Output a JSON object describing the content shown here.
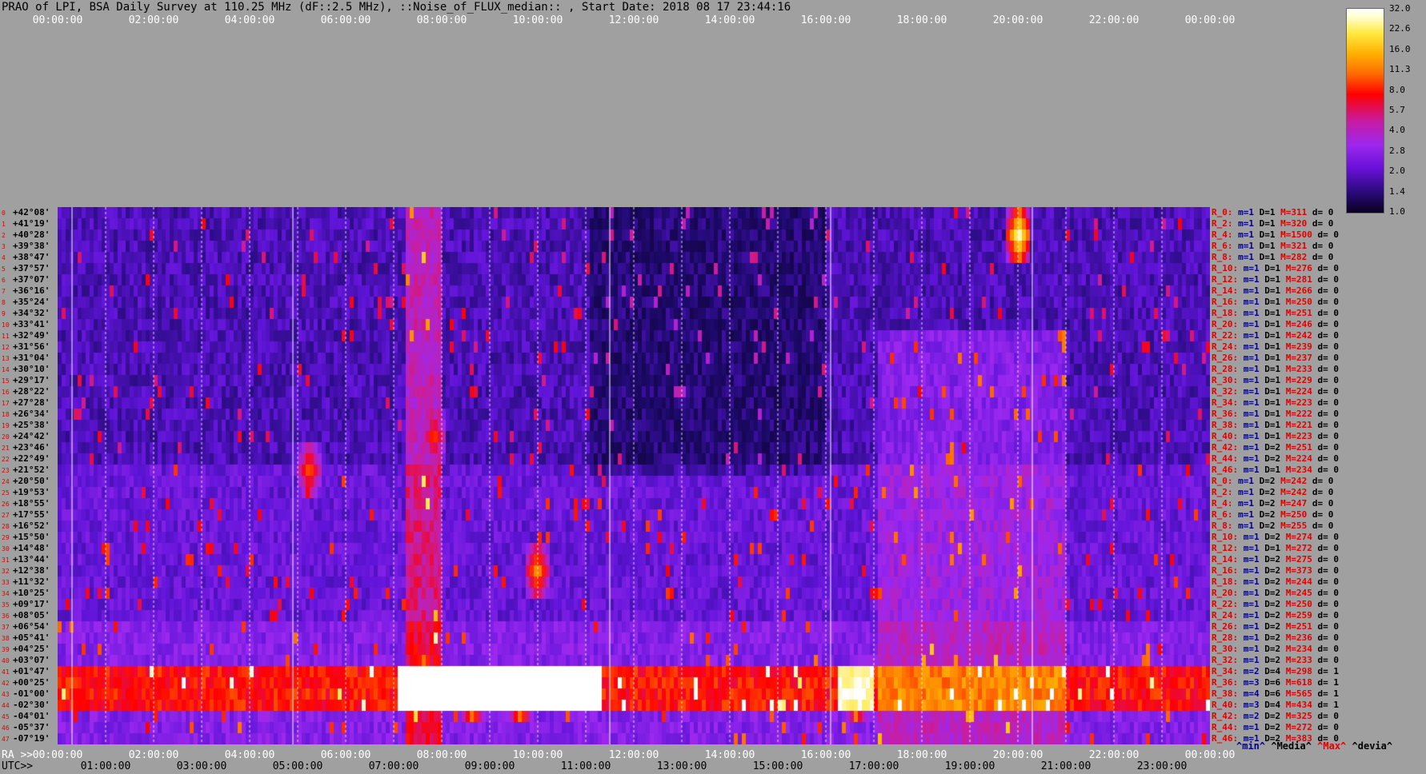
{
  "title": "PRAO of LPI, BSA Daily Survey at 110.25 MHz (dF::2.5 MHz), ::Noise_of_FLUX_median:: , Start Date: 2018 08 17 23:44:16",
  "chart_data": {
    "type": "heatmap",
    "title": "PRAO of LPI, BSA Daily Survey at 110.25 MHz (dF::2.5 MHz), ::Noise_of_FLUX_median:: , Start Date: 2018 08 17 23:44:16",
    "x_axis_top": [
      "00:00:00",
      "02:00:00",
      "04:00:00",
      "06:00:00",
      "08:00:00",
      "10:00:00",
      "12:00:00",
      "14:00:00",
      "16:00:00",
      "18:00:00",
      "20:00:00",
      "22:00:00",
      "00:00:00"
    ],
    "x_axis_ra_label": "RA >>",
    "x_axis_ra": [
      "00:00:00",
      "02:00:00",
      "04:00:00",
      "06:00:00",
      "08:00:00",
      "10:00:00",
      "12:00:00",
      "14:00:00",
      "16:00:00",
      "18:00:00",
      "20:00:00",
      "22:00:00",
      "00:00:00"
    ],
    "x_axis_utc_label": "UTC>>",
    "x_axis_utc": [
      "01:00:00",
      "03:00:00",
      "05:00:00",
      "07:00:00",
      "09:00:00",
      "11:00:00",
      "13:00:00",
      "15:00:00",
      "17:00:00",
      "19:00:00",
      "21:00:00",
      "23:00:00"
    ],
    "y_axis_declinations": [
      "+42°08'",
      "+41°19'",
      "+40°28'",
      "+39°38'",
      "+38°47'",
      "+37°57'",
      "+37°07'",
      "+36°16'",
      "+35°24'",
      "+34°32'",
      "+33°41'",
      "+32°49'",
      "+31°56'",
      "+31°04'",
      "+30°10'",
      "+29°17'",
      "+28°22'",
      "+27°28'",
      "+26°34'",
      "+25°38'",
      "+24°42'",
      "+23°46'",
      "+22°49'",
      "+21°52'",
      "+20°50'",
      "+19°53'",
      "+18°55'",
      "+17°55'",
      "+16°52'",
      "+15°50'",
      "+14°48'",
      "+13°44'",
      "+12°38'",
      "+11°32'",
      "+10°25'",
      "+09°17'",
      "+08°05'",
      "+06°54'",
      "+05°41'",
      "+04°25'",
      "+03°07'",
      "+01°47'",
      "+00°25'",
      "-01°00'",
      "-02°30'",
      "-04°01'",
      "-05°37'",
      "-07°19'"
    ],
    "colorbar": {
      "ticks": [
        "32.0",
        "22.6",
        "16.0",
        "11.3",
        "8.0",
        "5.7",
        "4.0",
        "2.8",
        "2.0",
        "1.4",
        "1.0"
      ],
      "scale": "log"
    },
    "hotspots": [
      {
        "ra_hours": 7.6,
        "dec_index": 42,
        "intensity": 32
      },
      {
        "ra_hours": 8.6,
        "dec_index": 43,
        "intensity": 32
      },
      {
        "ra_hours": 9.6,
        "dec_index": 43,
        "intensity": 32
      },
      {
        "ra_hours": 7.8,
        "dec_index": 20,
        "intensity": 11
      },
      {
        "ra_hours": 16.6,
        "dec_index": 43,
        "intensity": 22
      },
      {
        "ra_hours": 19.98,
        "dec_index": 2,
        "intensity": 32
      },
      {
        "ra_hours": 9.95,
        "dec_index": 32,
        "intensity": 16
      },
      {
        "ra_hours": 5.2,
        "dec_index": 23,
        "intensity": 12
      }
    ],
    "sources": [
      {
        "name": "R_0:",
        "m": "m=1",
        "D": "D=1",
        "M": "M=311",
        "d": "d= 0"
      },
      {
        "name": "R_2:",
        "m": "m=1",
        "D": "D=1",
        "M": "M=320",
        "d": "d= 0"
      },
      {
        "name": "R_4:",
        "m": "m=1",
        "D": "D=1",
        "M": "M=1500",
        "d": "d= 0"
      },
      {
        "name": "R_6:",
        "m": "m=1",
        "D": "D=1",
        "M": "M=321",
        "d": "d= 0"
      },
      {
        "name": "R_8:",
        "m": "m=1",
        "D": "D=1",
        "M": "M=282",
        "d": "d= 0"
      },
      {
        "name": "R_10:",
        "m": "m=1",
        "D": "D=1",
        "M": "M=276",
        "d": "d= 0"
      },
      {
        "name": "R_12:",
        "m": "m=1",
        "D": "D=1",
        "M": "M=281",
        "d": "d= 0"
      },
      {
        "name": "R_14:",
        "m": "m=1",
        "D": "D=1",
        "M": "M=266",
        "d": "d= 0"
      },
      {
        "name": "R_16:",
        "m": "m=1",
        "D": "D=1",
        "M": "M=250",
        "d": "d= 0"
      },
      {
        "name": "R_18:",
        "m": "m=1",
        "D": "D=1",
        "M": "M=251",
        "d": "d= 0"
      },
      {
        "name": "R_20:",
        "m": "m=1",
        "D": "D=1",
        "M": "M=246",
        "d": "d= 0"
      },
      {
        "name": "R_22:",
        "m": "m=1",
        "D": "D=1",
        "M": "M=242",
        "d": "d= 0"
      },
      {
        "name": "R_24:",
        "m": "m=1",
        "D": "D=1",
        "M": "M=239",
        "d": "d= 0"
      },
      {
        "name": "R_26:",
        "m": "m=1",
        "D": "D=1",
        "M": "M=237",
        "d": "d= 0"
      },
      {
        "name": "R_28:",
        "m": "m=1",
        "D": "D=1",
        "M": "M=233",
        "d": "d= 0"
      },
      {
        "name": "R_30:",
        "m": "m=1",
        "D": "D=1",
        "M": "M=229",
        "d": "d= 0"
      },
      {
        "name": "R_32:",
        "m": "m=1",
        "D": "D=1",
        "M": "M=224",
        "d": "d= 0"
      },
      {
        "name": "R_34:",
        "m": "m=1",
        "D": "D=1",
        "M": "M=223",
        "d": "d= 0"
      },
      {
        "name": "R_36:",
        "m": "m=1",
        "D": "D=1",
        "M": "M=222",
        "d": "d= 0"
      },
      {
        "name": "R_38:",
        "m": "m=1",
        "D": "D=1",
        "M": "M=221",
        "d": "d= 0"
      },
      {
        "name": "R_40:",
        "m": "m=1",
        "D": "D=1",
        "M": "M=223",
        "d": "d= 0"
      },
      {
        "name": "R_42:",
        "m": "m=1",
        "D": "D=2",
        "M": "M=251",
        "d": "d= 0"
      },
      {
        "name": "R_44:",
        "m": "m=1",
        "D": "D=2",
        "M": "M=224",
        "d": "d= 0"
      },
      {
        "name": "R_46:",
        "m": "m=1",
        "D": "D=1",
        "M": "M=234",
        "d": "d= 0"
      },
      {
        "name": "R_0:",
        "m": "m=1",
        "D": "D=2",
        "M": "M=242",
        "d": "d= 0"
      },
      {
        "name": "R_2:",
        "m": "m=1",
        "D": "D=2",
        "M": "M=242",
        "d": "d= 0"
      },
      {
        "name": "R_4:",
        "m": "m=1",
        "D": "D=2",
        "M": "M=247",
        "d": "d= 0"
      },
      {
        "name": "R_6:",
        "m": "m=1",
        "D": "D=2",
        "M": "M=250",
        "d": "d= 0"
      },
      {
        "name": "R_8:",
        "m": "m=1",
        "D": "D=2",
        "M": "M=255",
        "d": "d= 0"
      },
      {
        "name": "R_10:",
        "m": "m=1",
        "D": "D=2",
        "M": "M=274",
        "d": "d= 0"
      },
      {
        "name": "R_12:",
        "m": "m=1",
        "D": "D=1",
        "M": "M=272",
        "d": "d= 0"
      },
      {
        "name": "R_14:",
        "m": "m=1",
        "D": "D=2",
        "M": "M=275",
        "d": "d= 0"
      },
      {
        "name": "R_16:",
        "m": "m=1",
        "D": "D=2",
        "M": "M=373",
        "d": "d= 0"
      },
      {
        "name": "R_18:",
        "m": "m=1",
        "D": "D=2",
        "M": "M=244",
        "d": "d= 0"
      },
      {
        "name": "R_20:",
        "m": "m=1",
        "D": "D=2",
        "M": "M=245",
        "d": "d= 0"
      },
      {
        "name": "R_22:",
        "m": "m=1",
        "D": "D=2",
        "M": "M=250",
        "d": "d= 0"
      },
      {
        "name": "R_24:",
        "m": "m=1",
        "D": "D=2",
        "M": "M=259",
        "d": "d= 0"
      },
      {
        "name": "R_26:",
        "m": "m=1",
        "D": "D=2",
        "M": "M=251",
        "d": "d= 0"
      },
      {
        "name": "R_28:",
        "m": "m=1",
        "D": "D=2",
        "M": "M=236",
        "d": "d= 0"
      },
      {
        "name": "R_30:",
        "m": "m=1",
        "D": "D=2",
        "M": "M=234",
        "d": "d= 0"
      },
      {
        "name": "R_32:",
        "m": "m=1",
        "D": "D=2",
        "M": "M=233",
        "d": "d= 0"
      },
      {
        "name": "R_34:",
        "m": "m=2",
        "D": "D=4",
        "M": "M=298",
        "d": "d= 1"
      },
      {
        "name": "R_36:",
        "m": "m=3",
        "D": "D=6",
        "M": "M=618",
        "d": "d= 1"
      },
      {
        "name": "R_38:",
        "m": "m=4",
        "D": "D=6",
        "M": "M=565",
        "d": "d= 1"
      },
      {
        "name": "R_40:",
        "m": "m=3",
        "D": "D=4",
        "M": "M=434",
        "d": "d= 1"
      },
      {
        "name": "R_42:",
        "m": "m=2",
        "D": "D=2",
        "M": "M=325",
        "d": "d= 0"
      },
      {
        "name": "R_44:",
        "m": "m=1",
        "D": "D=2",
        "M": "M=272",
        "d": "d= 0"
      },
      {
        "name": "R_46:",
        "m": "m=1",
        "D": "D=2",
        "M": "M=383",
        "d": "d= 0"
      }
    ],
    "legend": [
      "^min^",
      "^Media^",
      "^Max^",
      "^devia^"
    ],
    "legend_colors": [
      "#00008b",
      "#000000",
      "#e00000",
      "#000000"
    ]
  }
}
